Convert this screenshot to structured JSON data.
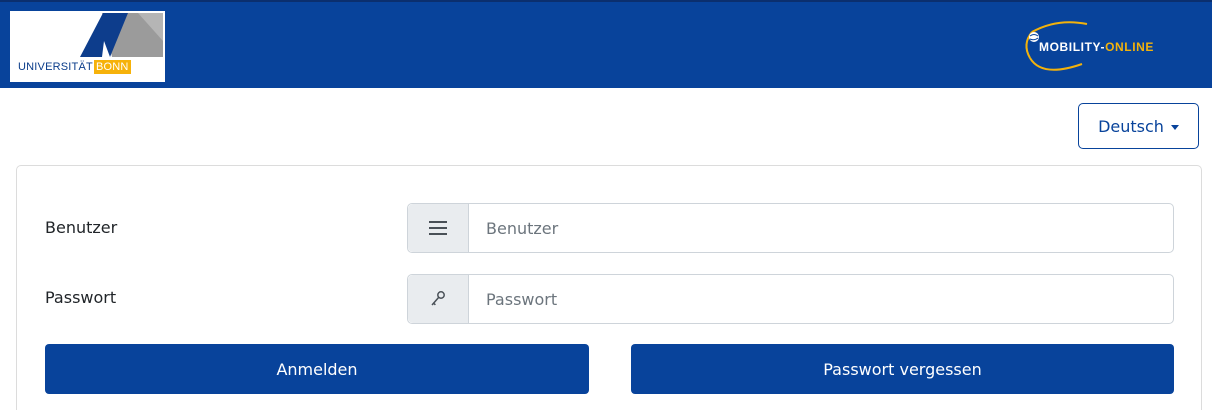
{
  "header": {
    "university_logo": {
      "text": "UNIVERSITÄT",
      "highlight": "BONN"
    },
    "mobility_logo": {
      "part1": "MOBILITY-",
      "part2": "ONLINE"
    },
    "colors": {
      "bar": "#08439b",
      "accent": "#f2b20c"
    }
  },
  "language": {
    "selected": "Deutsch"
  },
  "form": {
    "username": {
      "label": "Benutzer",
      "placeholder": "Benutzer",
      "icon": "menu-icon"
    },
    "password": {
      "label": "Passwort",
      "placeholder": "Passwort",
      "icon": "key-icon"
    },
    "login_button": "Anmelden",
    "forgot_button": "Passwort vergessen"
  }
}
